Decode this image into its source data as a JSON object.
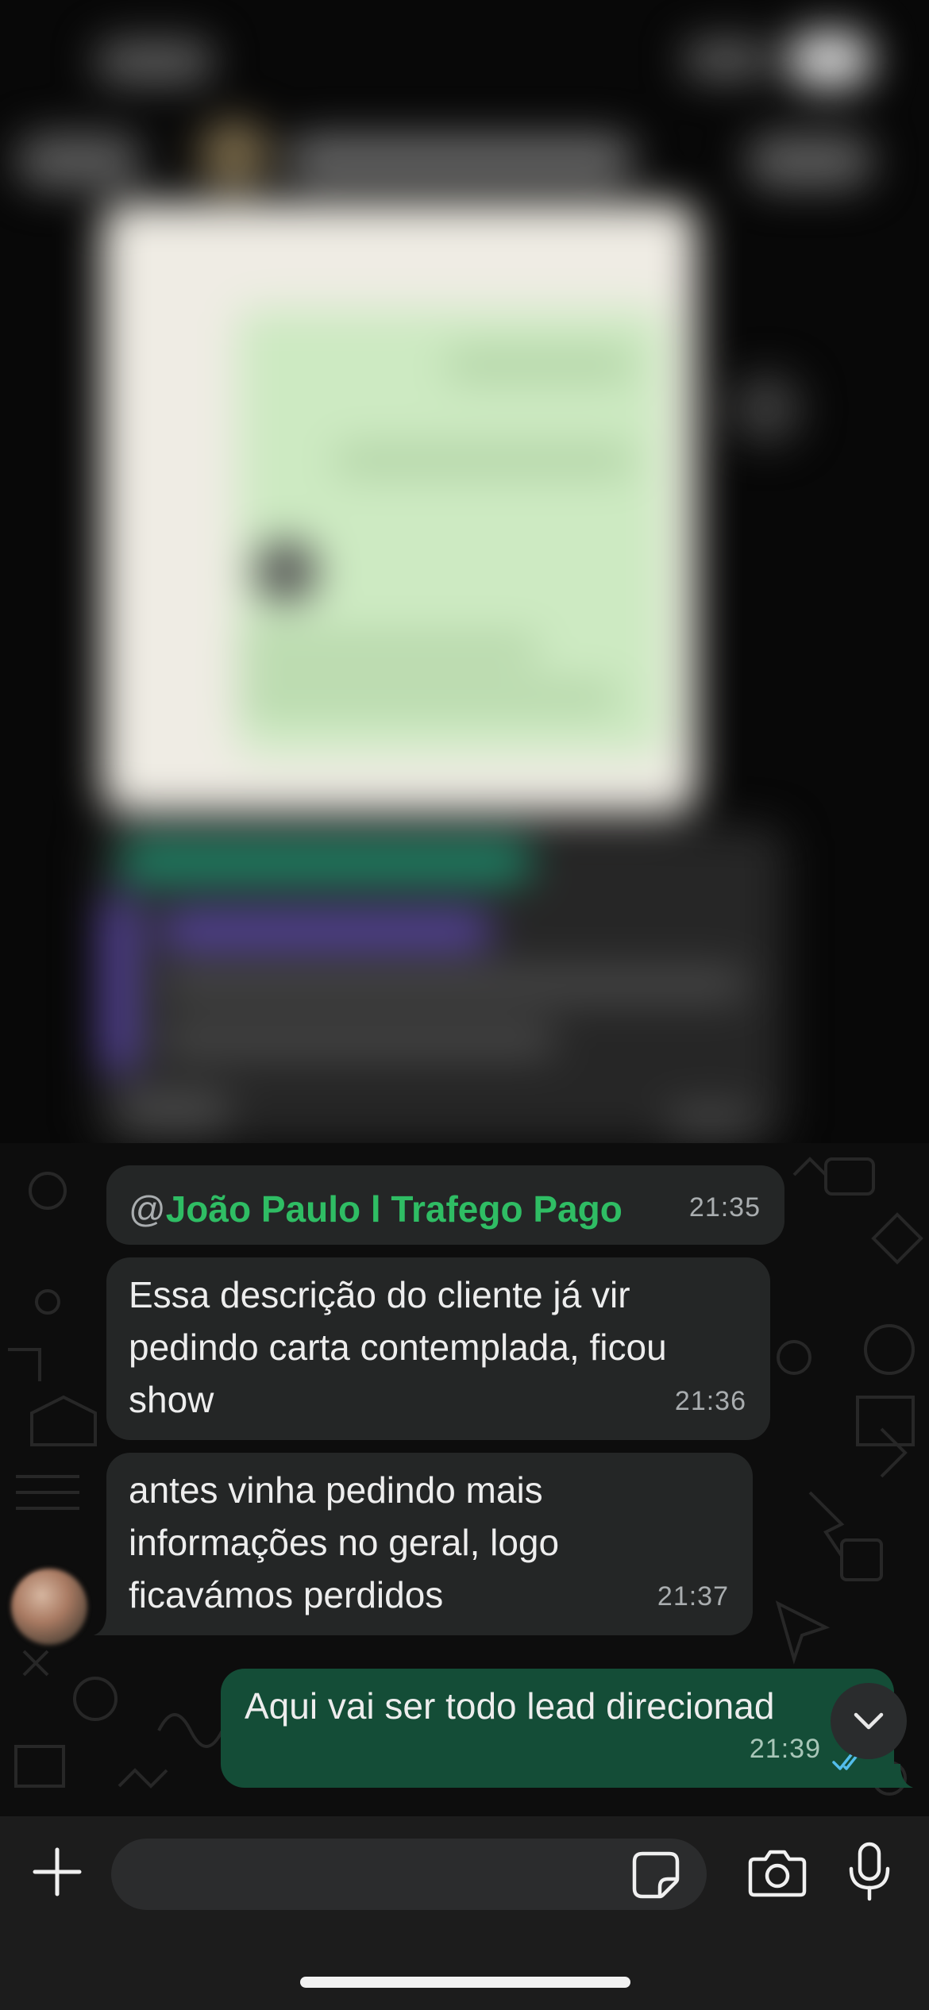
{
  "messages": [
    {
      "type": "mention",
      "at": "@",
      "name": "João Paulo l Trafego Pago",
      "time": "21:35"
    },
    {
      "type": "text",
      "text": "Essa descrição do cliente já vir\npedindo carta contemplada, ficou\nshow",
      "time": "21:36"
    },
    {
      "type": "text",
      "text": "antes vinha pedindo mais\ninformações no geral, logo\nficavámos perdidos",
      "time": "21:37"
    },
    {
      "type": "outgoing",
      "text": "Aqui vai ser todo lead direcionad",
      "time": "21:39",
      "status": "read"
    }
  ],
  "icons": {
    "attach": "plus-icon",
    "sticker": "sticker-icon",
    "camera": "camera-icon",
    "mic": "microphone-icon",
    "scroll": "chevron-down-icon",
    "read_receipt": "double-check-icon"
  },
  "colors": {
    "incoming_bubble": "#242626",
    "outgoing_bubble": "#144d37",
    "mention": "#2fbd64",
    "read_receipt": "#53bdeb",
    "background": "#0d0d0d"
  },
  "composer": {
    "value": ""
  }
}
